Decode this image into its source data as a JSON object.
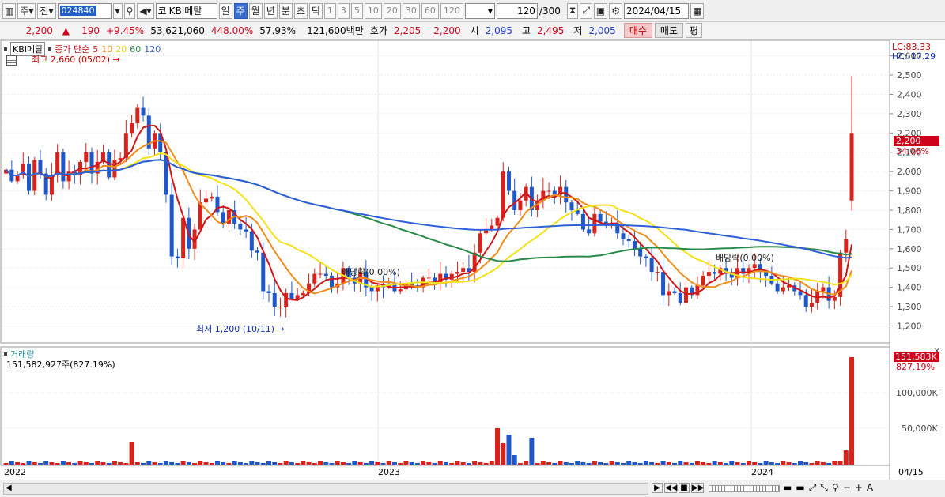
{
  "toolbar": {
    "t1": "주",
    "t2": "전",
    "code": "024840",
    "name_prefix": "코",
    "name": "KBI메탈",
    "periods": [
      "일",
      "주",
      "월",
      "년",
      "분",
      "초",
      "틱"
    ],
    "selected_period": "주",
    "nums": [
      "1",
      "3",
      "5",
      "10",
      "20",
      "30",
      "60",
      "120"
    ],
    "count": "120",
    "count_total": "/300",
    "date": "2024/04/15"
  },
  "quote": {
    "price": "2,200",
    "arrow": "▲",
    "change": "190",
    "change_pct": "+9.45%",
    "volume": "53,621,060",
    "vol_ratio": "448.00%",
    "turnover": "57.93%",
    "amount": "121,600백만",
    "bid_label": "호가",
    "bid": "2,205",
    "ask": "2,200",
    "open_label": "시",
    "open": "2,095",
    "high_label": "고",
    "high": "2,495",
    "low_label": "저",
    "low": "2,005",
    "buy": "매수",
    "sell": "매도",
    "p": "평"
  },
  "chart": {
    "name": "KBI메탈",
    "ma_label": "종가 단순",
    "ma": [
      "5",
      "10",
      "20",
      "60",
      "120"
    ],
    "ma_colors": [
      "#d01818",
      "#f08c1a",
      "#f3e21a",
      "#2a8a4a",
      "#2f5fd8"
    ],
    "max_label": "최고 2,660 (05/02)",
    "min_label": "최저 1,200 (10/11)",
    "div1": "배당락(0.00%)",
    "div2": "배당락(0.00%)",
    "lc": "LC:83.33",
    "hc": "HC:-17.29",
    "price_tag": "2,200",
    "pct_tag": "34.06%",
    "ylim": [
      1120,
      2660
    ],
    "yticks": [
      1200,
      1300,
      1400,
      1500,
      1600,
      1700,
      1800,
      1900,
      2000,
      2100,
      2200,
      2300,
      2400,
      2500,
      2600
    ],
    "ylabels": [
      "1,200",
      "1,300",
      "1,400",
      "1,500",
      "1,600",
      "1,700",
      "1,800",
      "1,900",
      "2,000",
      "2,100",
      "2,200",
      "2,300",
      "2,400",
      "2,500",
      "2,600"
    ]
  },
  "volume": {
    "label": "거래량",
    "value": "151,582,927주(827.19%)",
    "tag": "151,583K",
    "tag_pct": "827.19%",
    "yticks": [
      "100,000K",
      "50,000K"
    ]
  },
  "xaxis": {
    "labels": [
      "2022",
      "2023",
      "2024"
    ],
    "last": "04/15"
  },
  "chart_data": {
    "type": "candlestick",
    "x_start": "2022",
    "x_end": "04/15",
    "ylim": [
      1120,
      2660
    ],
    "closes": [
      2010,
      1950,
      1980,
      2040,
      1900,
      2060,
      1990,
      1880,
      1980,
      2100,
      1950,
      2000,
      1980,
      2050,
      2100,
      1990,
      2050,
      2100,
      1970,
      2060,
      2070,
      2200,
      2250,
      2330,
      2290,
      2120,
      2200,
      2100,
      1880,
      1560,
      1550,
      1760,
      1600,
      1700,
      1840,
      1860,
      1870,
      1790,
      1730,
      1800,
      1730,
      1700,
      1690,
      1590,
      1580,
      1380,
      1370,
      1300,
      1300,
      1370,
      1340,
      1360,
      1370,
      1420,
      1470,
      1470,
      1460,
      1400,
      1420,
      1500,
      1450,
      1420,
      1480,
      1400,
      1380,
      1410,
      1400,
      1420,
      1380,
      1390,
      1420,
      1410,
      1400,
      1450,
      1450,
      1420,
      1470,
      1440,
      1470,
      1480,
      1500,
      1480,
      1580,
      1680,
      1700,
      1720,
      1760,
      2000,
      1900,
      1800,
      1850,
      1920,
      1800,
      1850,
      1900,
      1900,
      1880,
      1920,
      1840,
      1800,
      1780,
      1700,
      1680,
      1780,
      1740,
      1730,
      1730,
      1680,
      1650,
      1640,
      1600,
      1560,
      1550,
      1480,
      1480,
      1360,
      1380,
      1370,
      1320,
      1400,
      1360,
      1410,
      1460,
      1480,
      1470,
      1500,
      1470,
      1450,
      1500,
      1470,
      1500,
      1520,
      1480,
      1460,
      1420,
      1380,
      1400,
      1410,
      1380,
      1360,
      1300,
      1320,
      1380,
      1400,
      1330,
      1350,
      1580,
      1650,
      2200
    ]
  }
}
